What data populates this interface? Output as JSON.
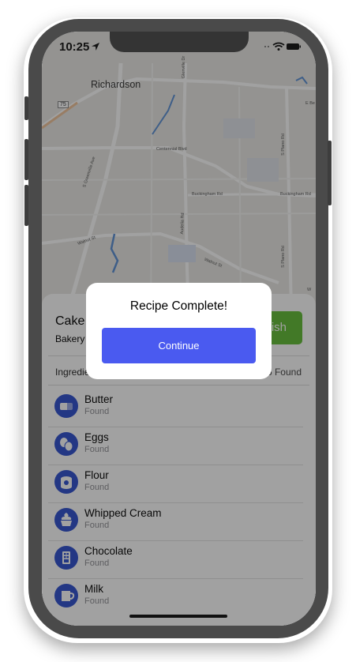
{
  "status_bar": {
    "time": "10:25"
  },
  "map": {
    "city_label": "Richardson",
    "route_shield": "75",
    "streets": [
      "S Greenville Ave",
      "Centennial Blvd",
      "Buckingham Rd",
      "Buckingham Rd",
      "Audelia Rd",
      "Walnut St",
      "Walnut St",
      "S Plano Rd",
      "S Plano Rd",
      "Glenville Dr",
      "E Be",
      "W"
    ]
  },
  "recipe": {
    "title": "Cake",
    "subtitle": "Bakery",
    "finish_label": "Finish",
    "ingredients_header": "Ingredients",
    "found_count": "6/6 Found"
  },
  "ingredients": [
    {
      "name": "Butter",
      "status": "Found",
      "icon": "butter-icon"
    },
    {
      "name": "Eggs",
      "status": "Found",
      "icon": "eggs-icon"
    },
    {
      "name": "Flour",
      "status": "Found",
      "icon": "flour-icon"
    },
    {
      "name": "Whipped Cream",
      "status": "Found",
      "icon": "whipped-cream-icon"
    },
    {
      "name": "Chocolate",
      "status": "Found",
      "icon": "chocolate-icon"
    },
    {
      "name": "Milk",
      "status": "Found",
      "icon": "milk-icon"
    }
  ],
  "modal": {
    "title": "Recipe Complete!",
    "button_label": "Continue"
  },
  "colors": {
    "accent_blue": "#4a5af0",
    "icon_blue": "#2d4fcf",
    "finish_green": "#61bd35",
    "device_frame": "#4a4a4a"
  }
}
